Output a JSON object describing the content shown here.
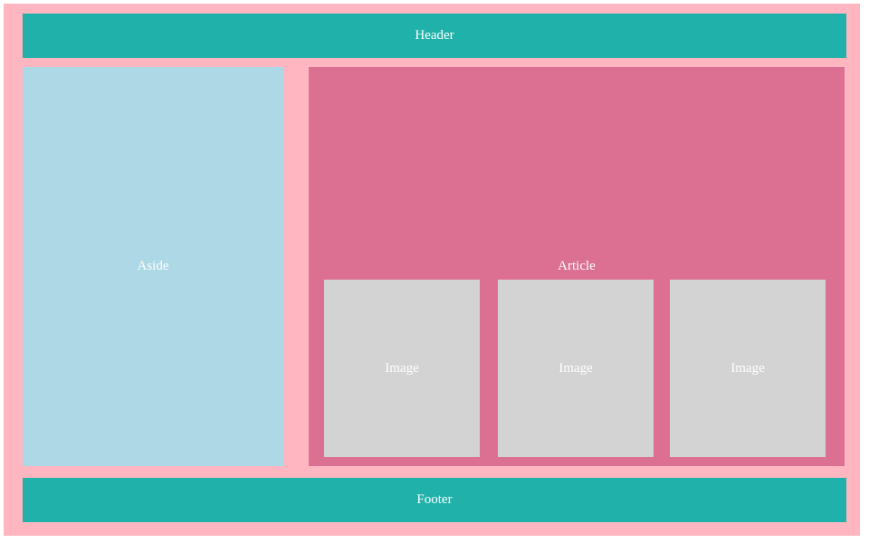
{
  "header": {
    "label": "Header"
  },
  "aside": {
    "label": "Aside"
  },
  "article": {
    "label": "Article",
    "images": [
      {
        "label": "Image"
      },
      {
        "label": "Image"
      },
      {
        "label": "Image"
      }
    ]
  },
  "footer": {
    "label": "Footer"
  },
  "colors": {
    "background": "#ffb6c1",
    "header": "#20b2aa",
    "aside": "#add8e6",
    "article": "#db7093",
    "image": "#d3d3d3",
    "footer": "#20b2aa",
    "text": "#ffffff"
  }
}
